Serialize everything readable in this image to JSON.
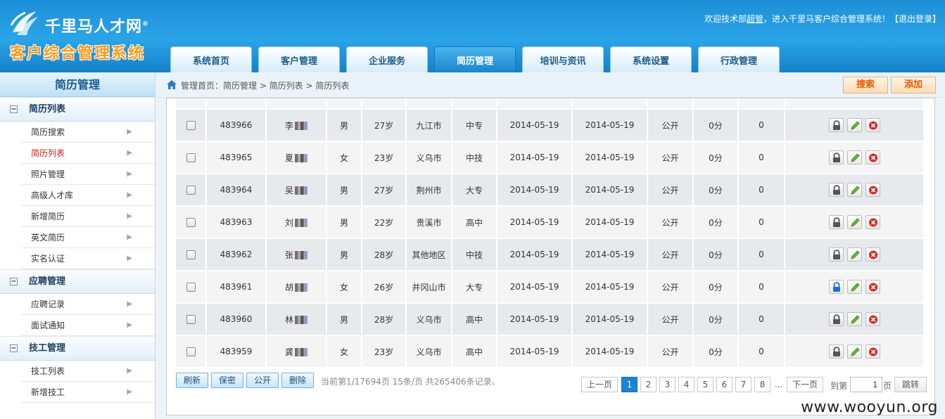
{
  "header": {
    "brand": "千里马人才网",
    "brand_mark": "®",
    "system_title": "客户综合管理系统",
    "welcome_prefix": "欢迎技术部",
    "welcome_user": "超管",
    "welcome_suffix": "，进入千里马客户综合管理系统！",
    "logout_label": "【退出登录】"
  },
  "nav": {
    "tabs": [
      {
        "label": "系统首页"
      },
      {
        "label": "客户管理"
      },
      {
        "label": "企业服务"
      },
      {
        "label": "简历管理"
      },
      {
        "label": "培训与资讯"
      },
      {
        "label": "系统设置"
      },
      {
        "label": "行政管理"
      }
    ],
    "active_index": 3
  },
  "sidebar": {
    "title": "简历管理",
    "groups": [
      {
        "label": "简历列表",
        "items": [
          {
            "label": "简历搜索"
          },
          {
            "label": "简历列表"
          },
          {
            "label": "照片管理"
          },
          {
            "label": "高级人才库"
          },
          {
            "label": "新增简历"
          },
          {
            "label": "英文简历"
          },
          {
            "label": "实名认证"
          }
        ]
      },
      {
        "label": "应聘管理",
        "items": [
          {
            "label": "应聘记录"
          },
          {
            "label": "面试通知"
          }
        ]
      },
      {
        "label": "技工管理",
        "items": [
          {
            "label": "技工列表"
          },
          {
            "label": "新增技工"
          }
        ]
      }
    ],
    "active_item": "简历列表"
  },
  "breadcrumb": {
    "text": "管理首页：简历管理 > 简历列表 > 简历列表"
  },
  "toolbar": {
    "search_label": "搜索",
    "add_label": "添加"
  },
  "table": {
    "rows": [
      {
        "id": "483966",
        "name": "李",
        "gender": "男",
        "age": "27岁",
        "city": "九江市",
        "education": "中专",
        "created": "2014-05-19",
        "updated": "2014-05-19",
        "visibility": "公开",
        "score": "0分",
        "count": "0",
        "locked": false
      },
      {
        "id": "483965",
        "name": "夏",
        "gender": "女",
        "age": "23岁",
        "city": "义乌市",
        "education": "中技",
        "created": "2014-05-19",
        "updated": "2014-05-19",
        "visibility": "公开",
        "score": "0分",
        "count": "0",
        "locked": false
      },
      {
        "id": "483964",
        "name": "吴",
        "gender": "男",
        "age": "27岁",
        "city": "荆州市",
        "education": "大专",
        "created": "2014-05-19",
        "updated": "2014-05-19",
        "visibility": "公开",
        "score": "0分",
        "count": "0",
        "locked": false
      },
      {
        "id": "483963",
        "name": "刘",
        "gender": "男",
        "age": "22岁",
        "city": "贵溪市",
        "education": "高中",
        "created": "2014-05-19",
        "updated": "2014-05-19",
        "visibility": "公开",
        "score": "0分",
        "count": "0",
        "locked": false
      },
      {
        "id": "483962",
        "name": "张",
        "gender": "男",
        "age": "28岁",
        "city": "其他地区",
        "education": "中技",
        "created": "2014-05-19",
        "updated": "2014-05-19",
        "visibility": "公开",
        "score": "0分",
        "count": "0",
        "locked": false
      },
      {
        "id": "483961",
        "name": "胡",
        "gender": "女",
        "age": "26岁",
        "city": "井冈山市",
        "education": "大专",
        "created": "2014-05-19",
        "updated": "2014-05-19",
        "visibility": "公开",
        "score": "0分",
        "count": "0",
        "locked": true
      },
      {
        "id": "483960",
        "name": "林",
        "gender": "男",
        "age": "28岁",
        "city": "义乌市",
        "education": "高中",
        "created": "2014-05-19",
        "updated": "2014-05-19",
        "visibility": "公开",
        "score": "0分",
        "count": "0",
        "locked": false
      },
      {
        "id": "483959",
        "name": "龚",
        "gender": "女",
        "age": "23岁",
        "city": "义乌市",
        "education": "高中",
        "created": "2014-05-19",
        "updated": "2014-05-19",
        "visibility": "公开",
        "score": "0分",
        "count": "0",
        "locked": false
      }
    ]
  },
  "bulk_actions": {
    "refresh": "刷新",
    "private": "保密",
    "public": "公开",
    "delete": "删除"
  },
  "pagination": {
    "info": "当前第1/17694页 15条/页 共265406条记录。",
    "prev": "上一页",
    "pages": [
      "1",
      "2",
      "3",
      "4",
      "5",
      "6",
      "7",
      "8"
    ],
    "current": "1",
    "ellipsis": "...",
    "next": "下一页",
    "goto_prefix": "到第",
    "goto_value": "1",
    "goto_suffix": "页",
    "goto_button": "跳转"
  },
  "watermark": "www.wooyun.org",
  "colors": {
    "header_blue": "#2aa4e8",
    "active_tab": "#1a86cc",
    "title_orange": "#ff9a1e",
    "active_sidebar_item": "#d21d1d",
    "page_active": "#1c83d6"
  }
}
